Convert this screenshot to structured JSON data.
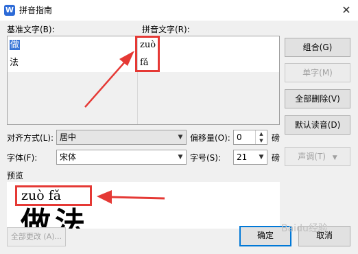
{
  "window": {
    "title": "拼音指南",
    "close_glyph": "✕",
    "app_icon_letter": "W"
  },
  "labels": {
    "base_text": "基准文字(B):",
    "pinyin_text": "拼音文字(R):",
    "alignment": "对齐方式(L):",
    "offset": "偏移量(O):",
    "offset_unit": "磅",
    "font": "字体(F):",
    "font_size": "字号(S):",
    "font_size_unit": "磅",
    "preview": "预览"
  },
  "grid": {
    "rows": [
      {
        "base": "做",
        "pinyin": "zuò"
      },
      {
        "base": "法",
        "pinyin": "fǎ"
      },
      {
        "base": "",
        "pinyin": ""
      },
      {
        "base": "",
        "pinyin": ""
      },
      {
        "base": "",
        "pinyin": ""
      }
    ]
  },
  "buttons": {
    "combine": "组合(G)",
    "single": "单字(M)",
    "delete_all": "全部删除(V)",
    "default_reading": "默认读音(D)",
    "tone": "声调(T)",
    "change_all": "全部更改 (A)...",
    "ok": "确定",
    "cancel": "取消"
  },
  "fields": {
    "alignment_value": "居中",
    "offset_value": "0",
    "font_value": "宋体",
    "font_size_value": "21"
  },
  "preview": {
    "pinyin": "zuò  fǎ",
    "text": "做法"
  },
  "watermark": "Baidu经验",
  "colors": {
    "annotation_red": "#e53935",
    "selection_blue": "#3875d7",
    "default_button_border": "#0078d7"
  },
  "icons": {
    "dropdown": "▼",
    "spin_up": "▲",
    "spin_down": "▼"
  }
}
